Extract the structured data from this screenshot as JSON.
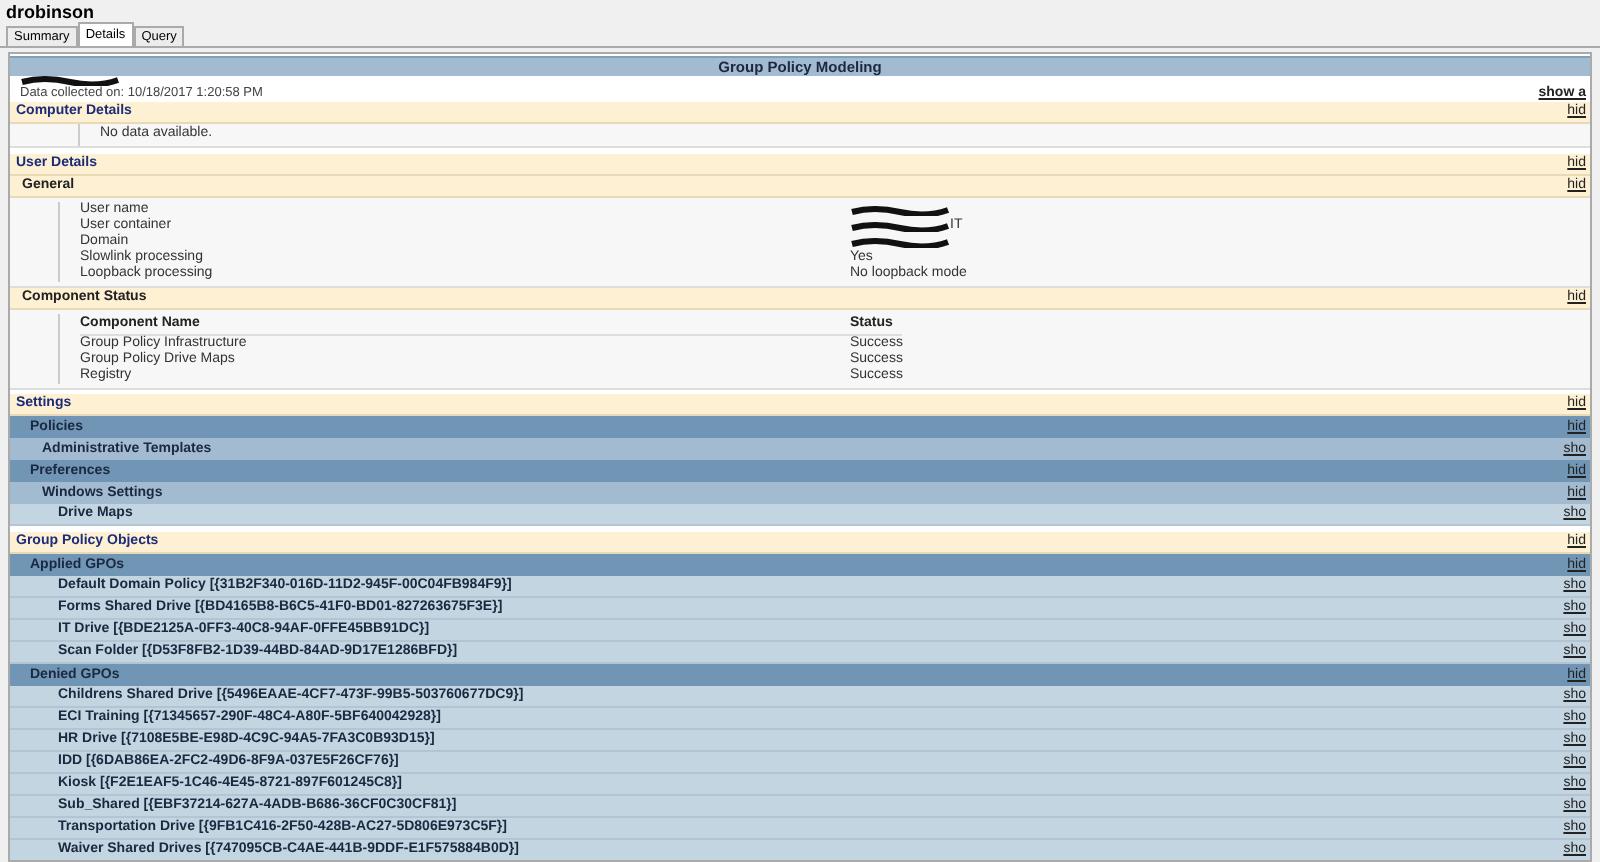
{
  "window": {
    "title": "drobinson"
  },
  "tabs": [
    {
      "label": "Summary",
      "selected": false
    },
    {
      "label": "Details",
      "selected": true
    },
    {
      "label": "Query",
      "selected": false
    }
  ],
  "report": {
    "title": "Group Policy Modeling",
    "collected": "Data collected on: 10/18/2017 1:20:58 PM",
    "show_all": "show a"
  },
  "rows": [
    {
      "kind": "section",
      "label": "Computer Details",
      "link": "hid"
    },
    {
      "kind": "note",
      "text": "No data available."
    },
    {
      "kind": "section",
      "label": "User Details",
      "link": "hid"
    },
    {
      "kind": "subsection",
      "label": "General",
      "link": "hid"
    },
    {
      "kind": "props",
      "items": [
        {
          "name": "User name",
          "redacted": true
        },
        {
          "name": "User container",
          "value": "IT",
          "redacted": true
        },
        {
          "name": "Domain",
          "redacted": true
        },
        {
          "name": "Slowlink processing",
          "value": "Yes",
          "redacted": false
        },
        {
          "name": "Loopback processing",
          "value": "No loopback mode",
          "redacted": false
        }
      ]
    },
    {
      "kind": "subsection",
      "label": "Component Status",
      "link": "hid"
    },
    {
      "kind": "table",
      "columns": [
        "Component Name",
        "Status"
      ],
      "rows": [
        [
          "Group Policy Infrastructure",
          "Success"
        ],
        [
          "Group Policy Drive Maps",
          "Success"
        ],
        [
          "Registry",
          "Success"
        ]
      ]
    },
    {
      "kind": "section",
      "label": "Settings",
      "link": "hid"
    },
    {
      "kind": "bar1",
      "label": "Policies",
      "link": "hid"
    },
    {
      "kind": "bar2",
      "label": "Administrative Templates",
      "link": "sho"
    },
    {
      "kind": "bar1",
      "label": "Preferences",
      "link": "hid"
    },
    {
      "kind": "bar2",
      "label": "Windows Settings",
      "link": "hid"
    },
    {
      "kind": "bar3",
      "label": "Drive Maps",
      "link": "sho"
    },
    {
      "kind": "section",
      "label": "Group Policy Objects",
      "link": "hid"
    },
    {
      "kind": "bar1",
      "label": "Applied GPOs",
      "link": "hid"
    },
    {
      "kind": "bar3",
      "label": "Default Domain Policy [{31B2F340-016D-11D2-945F-00C04FB984F9}]",
      "link": "sho"
    },
    {
      "kind": "bar3",
      "label": "Forms Shared Drive [{BD4165B8-B6C5-41F0-BD01-827263675F3E}]",
      "link": "sho"
    },
    {
      "kind": "bar3",
      "label": "IT Drive [{BDE2125A-0FF3-40C8-94AF-0FFE45BB91DC}]",
      "link": "sho"
    },
    {
      "kind": "bar3",
      "label": "Scan Folder [{D53F8FB2-1D39-44BD-84AD-9D17E1286BFD}]",
      "link": "sho"
    },
    {
      "kind": "bar1",
      "label": "Denied GPOs",
      "link": "hid"
    },
    {
      "kind": "bar3",
      "label": "Childrens Shared Drive [{5496EAAE-4CF7-473F-99B5-503760677DC9}]",
      "link": "sho"
    },
    {
      "kind": "bar3",
      "label": "ECI Training [{71345657-290F-48C4-A80F-5BF640042928}]",
      "link": "sho"
    },
    {
      "kind": "bar3",
      "label": "HR Drive [{7108E5BE-E98D-4C9C-94A5-7FA3C0B93D15}]",
      "link": "sho"
    },
    {
      "kind": "bar3",
      "label": "IDD [{6DAB86EA-2FC2-49D6-8F9A-037E5F26CF76}]",
      "link": "sho"
    },
    {
      "kind": "bar3",
      "label": "Kiosk [{F2E1EAF5-1C46-4E45-8721-897F601245C8}]",
      "link": "sho"
    },
    {
      "kind": "bar3",
      "label": "Sub_Shared [{EBF37214-627A-4ADB-B686-36CF0C30CF81}]",
      "link": "sho"
    },
    {
      "kind": "bar3",
      "label": "Transportation Drive [{9FB1C416-2F50-428B-AC27-5D806E973C5F}]",
      "link": "sho"
    },
    {
      "kind": "bar3",
      "label": "Waiver Shared Drives [{747095CB-C4AE-441B-9DDF-E1F575884B0D}]",
      "link": "sho"
    }
  ]
}
